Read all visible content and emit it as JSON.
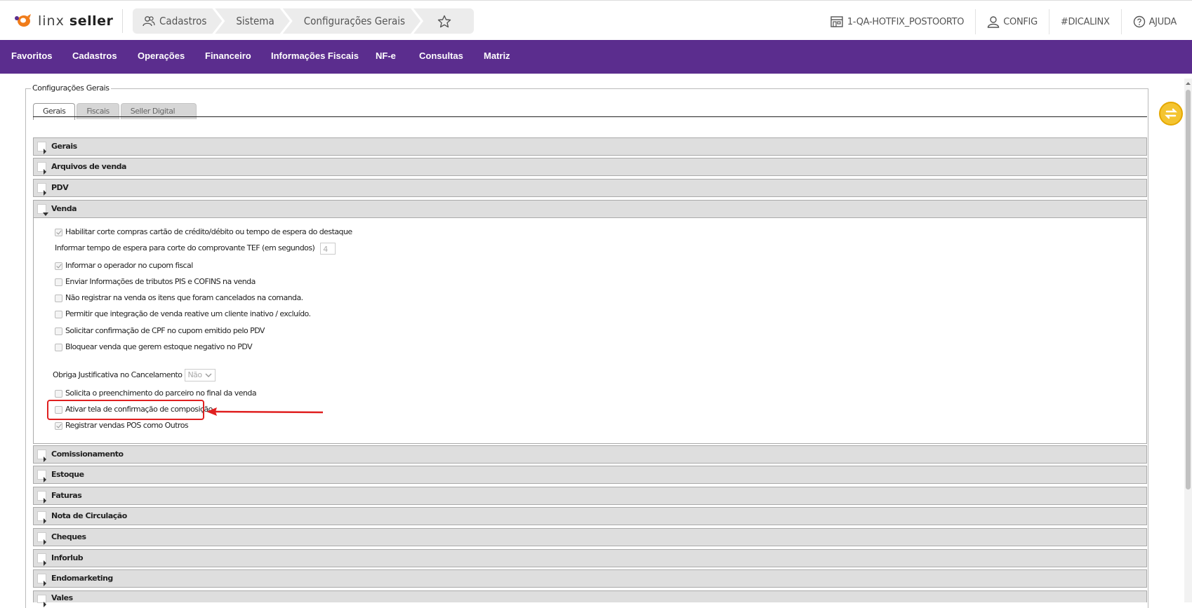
{
  "header": {
    "logo_text_light": "linx ",
    "logo_text_bold": "seller",
    "breadcrumb": [
      "Cadastros",
      "Sistema",
      "Configurações Gerais"
    ],
    "store": "1-QA-HOTFIX_POSTOORTO",
    "config": "CONFIG",
    "hashtag": "#DICALINX",
    "help": "AJUDA"
  },
  "nav": [
    "Favoritos",
    "Cadastros",
    "Operações",
    "Financeiro",
    "Informações Fiscais",
    "NF-e",
    "Consultas",
    "Matriz"
  ],
  "page": {
    "legend": "Configurações Gerais",
    "tabs": [
      "Gerais",
      "Fiscais",
      "Seller Digital"
    ],
    "active_tab": "Gerais"
  },
  "sections": {
    "gerais": "Gerais",
    "arquivos": "Arquivos de venda",
    "pdv": "PDV",
    "venda": "Venda",
    "comissionamento": "Comissionamento",
    "estoque": "Estoque",
    "faturas": "Faturas",
    "nota": "Nota de Circulação",
    "cheques": "Cheques",
    "inforlub": "Inforlub",
    "endomarketing": "Endomarketing",
    "vales": "Vales"
  },
  "venda": {
    "opt1": "Habilitar corte compras cartão de crédito/débito ou tempo de espera do destaque",
    "tef_label": "Informar tempo de espera para corte do comprovante TEF (em segundos)",
    "tef_value": "4",
    "opt2": "Informar o operador no cupom fiscal",
    "opt3": "Enviar Informações de tributos PIS e COFINS na venda",
    "opt4": "Não registrar na venda os itens que foram cancelados na comanda.",
    "opt5": "Permitir que integração de venda reative um cliente inativo / excluído.",
    "opt6": "Solicitar confirmação de CPF no cupom emitido pelo PDV",
    "opt7": "Bloquear venda que gerem estoque negativo no PDV",
    "just_label": "Obriga Justificativa no Cancelamento",
    "just_value": "Não",
    "opt8": "Solicita o preenchimento do parceiro no final da venda",
    "opt9": "Ativar tela de confirmação de composição",
    "opt10": "Registrar vendas POS como Outros"
  },
  "colors": {
    "nav_bg": "#5b2d8e",
    "highlight": "#e02020",
    "logo_orange": "#f07c1a"
  }
}
